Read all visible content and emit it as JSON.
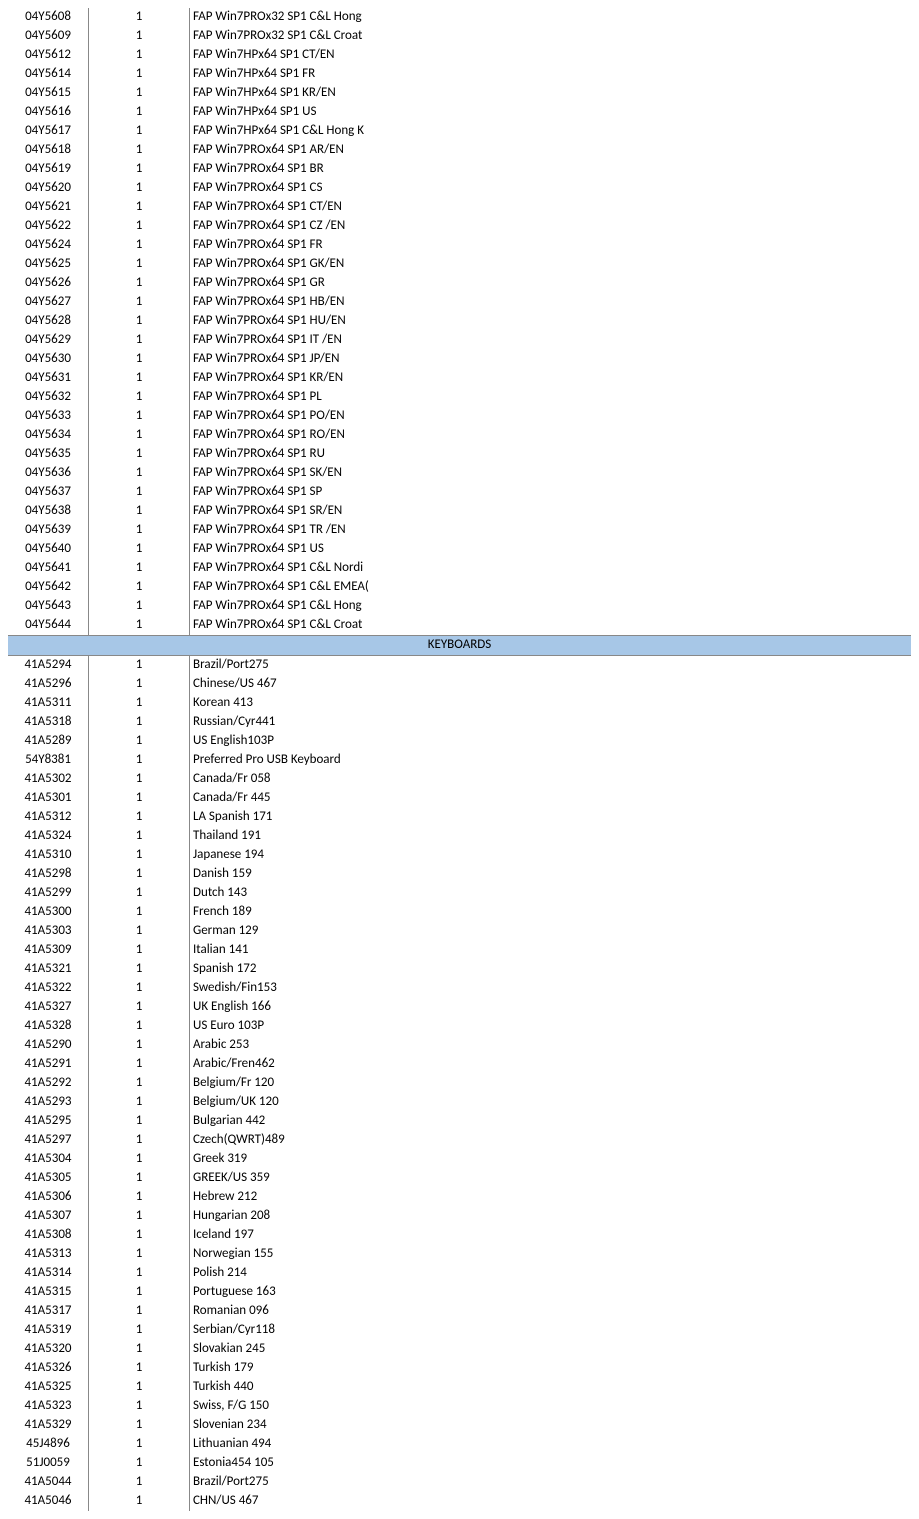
{
  "sections": [
    {
      "header": null,
      "rows": [
        {
          "code": "04Y5608",
          "qty": "1",
          "desc": "FAP Win7PROx32  SP1 C&L Hong"
        },
        {
          "code": "04Y5609",
          "qty": "1",
          "desc": "FAP Win7PROx32  SP1 C&L Croat"
        },
        {
          "code": "04Y5612",
          "qty": "1",
          "desc": "FAP Win7HPx64 SP1 CT/EN"
        },
        {
          "code": "04Y5614",
          "qty": "1",
          "desc": "FAP Win7HPx64 SP1 FR"
        },
        {
          "code": "04Y5615",
          "qty": "1",
          "desc": "FAP Win7HPx64 SP1 KR/EN"
        },
        {
          "code": "04Y5616",
          "qty": "1",
          "desc": "FAP Win7HPx64 SP1 US"
        },
        {
          "code": "04Y5617",
          "qty": "1",
          "desc": "FAP Win7HPx64 SP1 C&L Hong K"
        },
        {
          "code": "04Y5618",
          "qty": "1",
          "desc": "FAP Win7PROx64  SP1 AR/EN"
        },
        {
          "code": "04Y5619",
          "qty": "1",
          "desc": "FAP Win7PROx64  SP1 BR"
        },
        {
          "code": "04Y5620",
          "qty": "1",
          "desc": "FAP Win7PROx64  SP1 CS"
        },
        {
          "code": "04Y5621",
          "qty": "1",
          "desc": "FAP Win7PROx64  SP1 CT/EN"
        },
        {
          "code": "04Y5622",
          "qty": "1",
          "desc": "FAP Win7PROx64  SP1 CZ /EN"
        },
        {
          "code": "04Y5624",
          "qty": "1",
          "desc": "FAP Win7PROx64  SP1 FR"
        },
        {
          "code": "04Y5625",
          "qty": "1",
          "desc": "FAP Win7PROx64  SP1 GK/EN"
        },
        {
          "code": "04Y5626",
          "qty": "1",
          "desc": "FAP Win7PROx64  SP1 GR"
        },
        {
          "code": "04Y5627",
          "qty": "1",
          "desc": "FAP Win7PROx64  SP1 HB/EN"
        },
        {
          "code": "04Y5628",
          "qty": "1",
          "desc": "FAP Win7PROx64  SP1 HU/EN"
        },
        {
          "code": "04Y5629",
          "qty": "1",
          "desc": "FAP Win7PROx64  SP1 IT /EN"
        },
        {
          "code": "04Y5630",
          "qty": "1",
          "desc": "FAP Win7PROx64  SP1 JP/EN"
        },
        {
          "code": "04Y5631",
          "qty": "1",
          "desc": "FAP Win7PROx64  SP1 KR/EN"
        },
        {
          "code": "04Y5632",
          "qty": "1",
          "desc": "FAP Win7PROx64  SP1 PL"
        },
        {
          "code": "04Y5633",
          "qty": "1",
          "desc": "FAP Win7PROx64  SP1 PO/EN"
        },
        {
          "code": "04Y5634",
          "qty": "1",
          "desc": "FAP Win7PROx64  SP1 RO/EN"
        },
        {
          "code": "04Y5635",
          "qty": "1",
          "desc": "FAP Win7PROx64  SP1 RU"
        },
        {
          "code": "04Y5636",
          "qty": "1",
          "desc": "FAP Win7PROx64  SP1 SK/EN"
        },
        {
          "code": "04Y5637",
          "qty": "1",
          "desc": "FAP Win7PROx64  SP1 SP"
        },
        {
          "code": "04Y5638",
          "qty": "1",
          "desc": "FAP Win7PROx64  SP1 SR/EN"
        },
        {
          "code": "04Y5639",
          "qty": "1",
          "desc": "FAP Win7PROx64  SP1 TR /EN"
        },
        {
          "code": "04Y5640",
          "qty": "1",
          "desc": "FAP Win7PROx64  SP1 US"
        },
        {
          "code": "04Y5641",
          "qty": "1",
          "desc": "FAP Win7PROx64  SP1 C&L Nordi"
        },
        {
          "code": "04Y5642",
          "qty": "1",
          "desc": "FAP Win7PROx64  SP1 C&L EMEA("
        },
        {
          "code": "04Y5643",
          "qty": "1",
          "desc": "FAP Win7PROx64  SP1 C&L Hong"
        },
        {
          "code": "04Y5644",
          "qty": "1",
          "desc": "FAP Win7PROx64  SP1 C&L Croat"
        }
      ]
    },
    {
      "header": "KEYBOARDS",
      "rows": [
        {
          "code": "41A5294",
          "qty": "1",
          "desc": "Brazil/Port275"
        },
        {
          "code": "41A5296",
          "qty": "1",
          "desc": "Chinese/US 467"
        },
        {
          "code": "41A5311",
          "qty": "1",
          "desc": "Korean 413"
        },
        {
          "code": "41A5318",
          "qty": "1",
          "desc": "Russian/Cyr441"
        },
        {
          "code": "41A5289",
          "qty": "1",
          "desc": "US English103P"
        },
        {
          "code": "54Y8381",
          "qty": "1",
          "desc": "Preferred Pro USB Keyboard"
        },
        {
          "code": "41A5302",
          "qty": "1",
          "desc": "Canada/Fr 058"
        },
        {
          "code": "41A5301",
          "qty": "1",
          "desc": "Canada/Fr 445"
        },
        {
          "code": "41A5312",
          "qty": "1",
          "desc": "LA Spanish 171"
        },
        {
          "code": "41A5324",
          "qty": "1",
          "desc": "Thailand 191"
        },
        {
          "code": "41A5310",
          "qty": "1",
          "desc": "Japanese 194"
        },
        {
          "code": "41A5298",
          "qty": "1",
          "desc": "Danish 159"
        },
        {
          "code": "41A5299",
          "qty": "1",
          "desc": "Dutch 143"
        },
        {
          "code": "41A5300",
          "qty": "1",
          "desc": "French 189"
        },
        {
          "code": "41A5303",
          "qty": "1",
          "desc": "German 129"
        },
        {
          "code": "41A5309",
          "qty": "1",
          "desc": "Italian 141"
        },
        {
          "code": "41A5321",
          "qty": "1",
          "desc": "Spanish 172"
        },
        {
          "code": "41A5322",
          "qty": "1",
          "desc": "Swedish/Fin153"
        },
        {
          "code": "41A5327",
          "qty": "1",
          "desc": "UK English 166"
        },
        {
          "code": "41A5328",
          "qty": "1",
          "desc": "US Euro  103P"
        },
        {
          "code": "41A5290",
          "qty": "1",
          "desc": "Arabic 253"
        },
        {
          "code": "41A5291",
          "qty": "1",
          "desc": "Arabic/Fren462"
        },
        {
          "code": "41A5292",
          "qty": "1",
          "desc": "Belgium/Fr 120"
        },
        {
          "code": "41A5293",
          "qty": "1",
          "desc": "Belgium/UK 120"
        },
        {
          "code": "41A5295",
          "qty": "1",
          "desc": "Bulgarian 442"
        },
        {
          "code": "41A5297",
          "qty": "1",
          "desc": "Czech(QWRT)489"
        },
        {
          "code": "41A5304",
          "qty": "1",
          "desc": "Greek 319"
        },
        {
          "code": "41A5305",
          "qty": "1",
          "desc": "GREEK/US 359"
        },
        {
          "code": "41A5306",
          "qty": "1",
          "desc": "Hebrew 212"
        },
        {
          "code": "41A5307",
          "qty": "1",
          "desc": "Hungarian 208"
        },
        {
          "code": "41A5308",
          "qty": "1",
          "desc": "Iceland 197"
        },
        {
          "code": "41A5313",
          "qty": "1",
          "desc": "Norwegian 155"
        },
        {
          "code": "41A5314",
          "qty": "1",
          "desc": "Polish 214"
        },
        {
          "code": "41A5315",
          "qty": "1",
          "desc": "Portuguese 163"
        },
        {
          "code": "41A5317",
          "qty": "1",
          "desc": "Romanian 096"
        },
        {
          "code": "41A5319",
          "qty": "1",
          "desc": "Serbian/Cyr118"
        },
        {
          "code": "41A5320",
          "qty": "1",
          "desc": "Slovakian 245"
        },
        {
          "code": "41A5326",
          "qty": "1",
          "desc": "Turkish 179"
        },
        {
          "code": "41A5325",
          "qty": "1",
          "desc": "Turkish 440"
        },
        {
          "code": "41A5323",
          "qty": "1",
          "desc": "Swiss, F/G 150"
        },
        {
          "code": "41A5329",
          "qty": "1",
          "desc": "Slovenian 234"
        },
        {
          "code": "45J4896",
          "qty": "1",
          "desc": "Lithuanian 494"
        },
        {
          "code": "51J0059",
          "qty": "1",
          "desc": "Estonia454 105"
        },
        {
          "code": "41A5044",
          "qty": "1",
          "desc": "Brazil/Port275"
        },
        {
          "code": "41A5046",
          "qty": "1",
          "desc": "CHN/US 467"
        }
      ]
    }
  ]
}
